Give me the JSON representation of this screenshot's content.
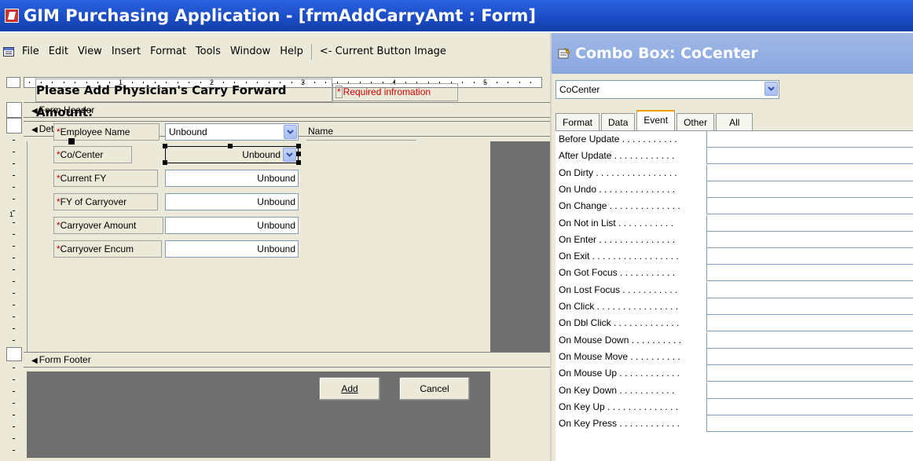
{
  "app": {
    "title": "GIM Purchasing Application - [frmAddCarryAmt : Form]"
  },
  "menu": {
    "items": [
      "File",
      "Edit",
      "View",
      "Insert",
      "Format",
      "Tools",
      "Window",
      "Help"
    ],
    "extra": "<- Current Button Image"
  },
  "ruler": {
    "numbers": [
      "1",
      "2",
      "3",
      "4",
      "5"
    ],
    "vertical_number": "1"
  },
  "sections": {
    "header": "Form Header",
    "detail": "Detail",
    "footer": "Form Footer"
  },
  "form": {
    "heading": "Please Add Physician's Carry Forward Amount:",
    "required_star": "*",
    "required_text": "Required infromation",
    "name_label": "Name",
    "fields": [
      {
        "label": "Employee Name",
        "value": "Unbound"
      },
      {
        "label": "Co/Center",
        "value": "Unbound"
      },
      {
        "label": "Current FY",
        "value": "Unbound"
      },
      {
        "label": "FY of Carryover",
        "value": "Unbound"
      },
      {
        "label": "Carryover Amount",
        "value": "Unbound"
      },
      {
        "label": "Carryover Encum",
        "value": "Unbound"
      }
    ],
    "buttons": {
      "add": "Add",
      "cancel": "Cancel"
    }
  },
  "properties": {
    "title": "Combo Box: CoCenter",
    "selected_object": "CoCenter",
    "tabs": [
      "Format",
      "Data",
      "Event",
      "Other",
      "All"
    ],
    "active_tab": "Event",
    "rows": [
      "Before Update . . . . . . . . . . .",
      "After Update . . . . . . . . . . . .",
      "On Dirty . . . . . . . . . . . . . . . .",
      "On Undo . . . . . . . . . . . . . . .",
      "On Change . . . . . . . . . . . . . .",
      "On Not in List . . . . . . . . . . .",
      "On Enter . . . . . . . . . . . . . . .",
      "On Exit . . . . . . . . . . . . . . . . .",
      "On Got Focus . . . . . . . . . . .",
      "On Lost Focus . . . . . . . . . . .",
      "On Click . . . . . . . . . . . . . . . .",
      "On Dbl Click . . . . . . . . . . . . .",
      "On Mouse Down . . . . . . . . . .",
      "On Mouse Move . . . . . . . . . .",
      "On Mouse Up . . . . . . . . . . . .",
      "On Key Down . . . . . . . . . . .",
      "On Key Up . . . . . . . . . . . . . .",
      "On Key Press . . . . . . . . . . . ."
    ]
  },
  "colors": {
    "title_bar": "#1b4bc4",
    "required_red": "#d00000",
    "designer_bg": "#ece9d8",
    "dark_gray": "#6f6f6f",
    "active_tab_accent": "#f0a000"
  }
}
